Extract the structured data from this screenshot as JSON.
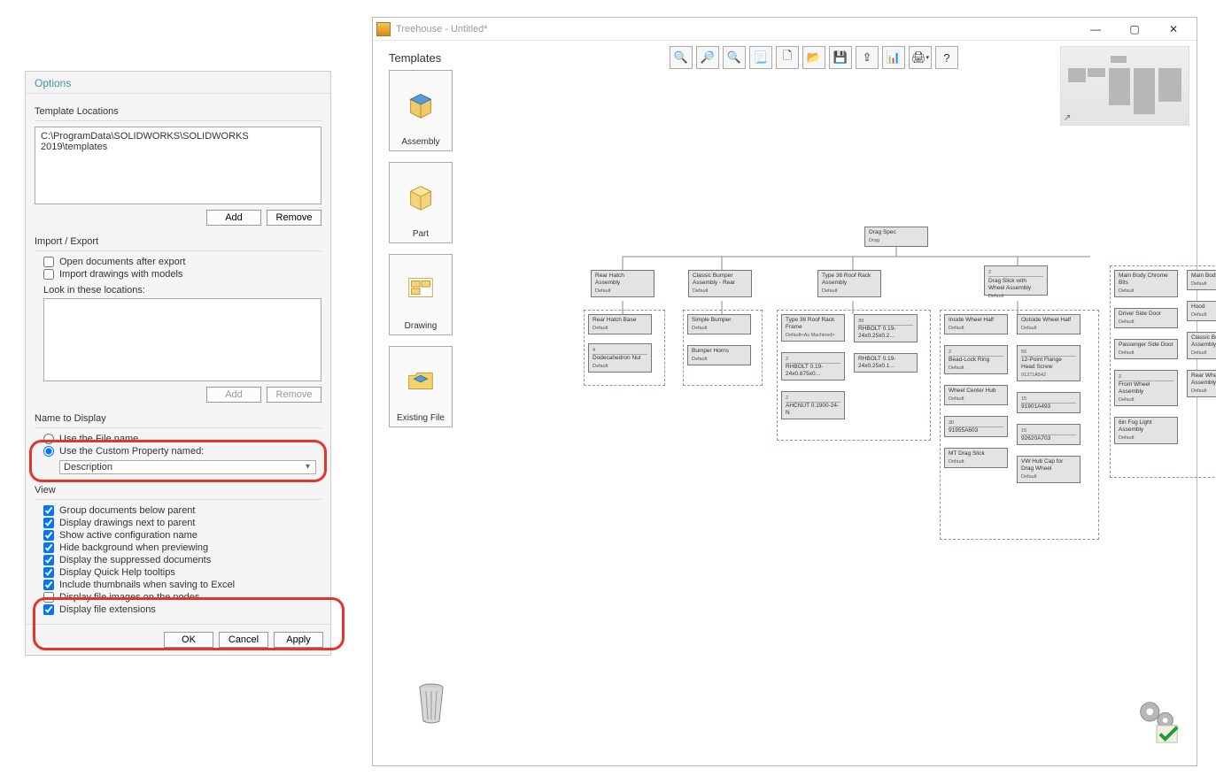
{
  "options": {
    "title": "Options",
    "templateLocations": {
      "label": "Template Locations",
      "path": "C:\\ProgramData\\SOLIDWORKS\\SOLIDWORKS 2019\\templates",
      "addLabel": "Add",
      "removeLabel": "Remove"
    },
    "importExport": {
      "label": "Import / Export",
      "openAfterExport": {
        "label": "Open documents after export",
        "checked": false
      },
      "importDrawings": {
        "label": "Import drawings with models",
        "checked": false
      },
      "lookLabel": "Look in these locations:",
      "addLabel": "Add",
      "removeLabel": "Remove"
    },
    "nameToDisplay": {
      "label": "Name to Display",
      "useFileName": {
        "label": "Use the File name",
        "selected": false
      },
      "useCustomProp": {
        "label": "Use the Custom Property named:",
        "selected": true
      },
      "propertyValue": "Description"
    },
    "view": {
      "label": "View",
      "groupBelowParent": {
        "label": "Group documents below parent",
        "checked": true
      },
      "drawingsNextToParent": {
        "label": "Display drawings next to parent",
        "checked": true
      },
      "showActiveConfig": {
        "label": "Show active configuration name",
        "checked": true
      },
      "hideBackground": {
        "label": "Hide background when previewing",
        "checked": true
      },
      "displaySuppressed": {
        "label": "Display the suppressed documents",
        "checked": true
      },
      "quickHelp": {
        "label": "Display Quick Help tooltips",
        "checked": true
      },
      "includeThumbnails": {
        "label": "Include thumbnails when saving to Excel",
        "checked": true
      },
      "displayFileImages": {
        "label": "Display file images on the nodes",
        "checked": false
      },
      "displayFileExt": {
        "label": "Display file extensions",
        "checked": true
      }
    },
    "buttons": {
      "ok": "OK",
      "cancel": "Cancel",
      "apply": "Apply"
    }
  },
  "treehouse": {
    "winTitle": "Treehouse - Untitled*",
    "templatesHeading": "Templates",
    "templateItems": [
      {
        "label": "Assembly"
      },
      {
        "label": "Part"
      },
      {
        "label": "Drawing"
      },
      {
        "label": "Existing File"
      }
    ],
    "toolbarIcons": [
      "zoom-in",
      "zoom-out",
      "zoom-fit",
      "document",
      "new-doc",
      "open",
      "save",
      "export-sw",
      "export-excel",
      "print",
      "help"
    ],
    "root": {
      "name": "Drag Spec",
      "cfg": "Drag"
    },
    "level1": [
      {
        "name": "Rear Hatch Assembly",
        "cfg": "Default"
      },
      {
        "name": "Classic Bumper Assembly - Rear",
        "cfg": "Default"
      },
      {
        "name": "Type 36 Roof Rack Assembly",
        "cfg": "Default"
      },
      {
        "qty": "2",
        "name": "Drag Slick with Wheel Assembly",
        "cfg": "Default"
      }
    ],
    "groups": {
      "g0": [
        {
          "name": "Rear Hatch Base",
          "cfg": "Default"
        },
        {
          "qty": "4",
          "name": "Dodecahedron Nut",
          "cfg": "Default",
          "stacked": true
        }
      ],
      "g1": [
        {
          "name": "Simple Bumper",
          "cfg": "Default"
        },
        {
          "name": "Bumper Horns",
          "cfg": "Default"
        }
      ],
      "g2a": [
        {
          "name": "Type 36 Roof Rack Frame",
          "cfg": "Default<As Machined>"
        },
        {
          "qty": "2",
          "name": "RHBOLT 0.19-24x0.875x0...",
          "stacked": true
        },
        {
          "qty": "2",
          "name": "AHCNUT 0.1900-24-N",
          "stacked": true
        }
      ],
      "g2b": [
        {
          "qty": "39",
          "name": "RHBOLT 0.19-24x0.25x0.2...",
          "stacked": true
        },
        {
          "name": "RHBOLT 0.19-24x0.25x0.1..."
        }
      ],
      "g3a": [
        {
          "name": "Inside Wheel Half",
          "cfg": "Default"
        },
        {
          "qty": "2",
          "name": "Bead-Lock Ring",
          "cfg": "Default",
          "stacked": true
        },
        {
          "name": "Wheel Center Hub",
          "cfg": "Default"
        },
        {
          "qty": "30",
          "name": "91955A603",
          "stacked": true
        },
        {
          "name": "MT Drag Slick",
          "cfg": "Default"
        }
      ],
      "g3b": [
        {
          "name": "Outside Wheel Half",
          "cfg": "Default"
        },
        {
          "qty": "56",
          "name": "12-Point Flange Head Screw",
          "cfg": "91271A542",
          "stacked": true
        },
        {
          "qty": "15",
          "name": "91901A493",
          "stacked": true
        },
        {
          "qty": "15",
          "name": "92620A703",
          "stacked": true
        },
        {
          "name": "VW Hub Cap for Drag Wheel",
          "cfg": "Default"
        }
      ],
      "g4a": [
        {
          "name": "Main Body Chrome Bits",
          "cfg": "Default"
        },
        {
          "name": "Driver Side Door",
          "cfg": "Default"
        },
        {
          "name": "Passenger Side Door",
          "cfg": "Default"
        },
        {
          "qty": "2",
          "name": "Front Wheel Assembly",
          "cfg": "Default",
          "stacked": true
        },
        {
          "name": "6in Fog Light Assembly",
          "cfg": "Default"
        }
      ],
      "g4b": [
        {
          "name": "Main Body",
          "cfg": "Default"
        },
        {
          "name": "Hood",
          "cfg": "Default"
        },
        {
          "name": "Classic Bumber Assembly - Front",
          "cfg": "Default"
        },
        {
          "name": "Rear Wheel Assembly",
          "cfg": "Default"
        }
      ]
    }
  }
}
